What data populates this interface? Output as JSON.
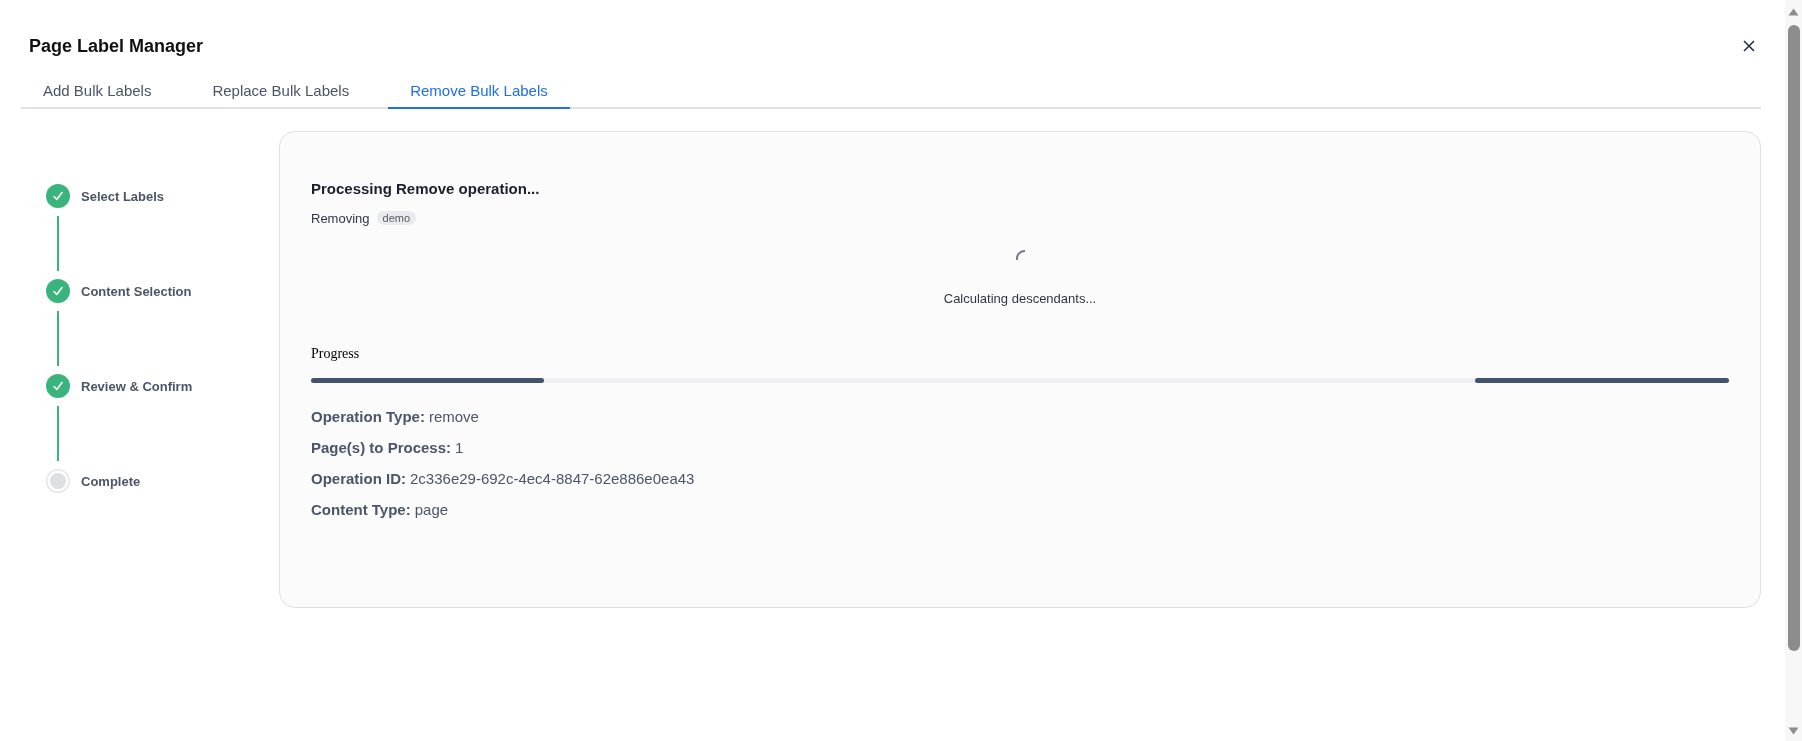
{
  "dialog": {
    "title": "Page Label Manager"
  },
  "tabs": [
    {
      "label": "Add Bulk Labels",
      "selected": false
    },
    {
      "label": "Replace Bulk Labels",
      "selected": false
    },
    {
      "label": "Remove Bulk Labels",
      "selected": true
    }
  ],
  "steps": [
    {
      "label": "Select Labels",
      "completed": true
    },
    {
      "label": "Content Selection",
      "completed": true
    },
    {
      "label": "Review & Confirm",
      "completed": true
    },
    {
      "label": "Complete",
      "completed": false
    }
  ],
  "processing": {
    "heading": "Processing Remove operation...",
    "removing_label": "Removing",
    "labels": [
      "demo"
    ],
    "status": "Calculating descendants...",
    "progress": {
      "label": "Progress",
      "indeterminate": true
    },
    "details": [
      {
        "label": "Operation Type:",
        "value": "remove"
      },
      {
        "label": "Page(s) to Process:",
        "value": "1"
      },
      {
        "label": "Operation ID:",
        "value": "2c336e29-692c-4ec4-8847-62e886e0ea43"
      },
      {
        "label": "Content Type:",
        "value": "page"
      }
    ]
  }
}
